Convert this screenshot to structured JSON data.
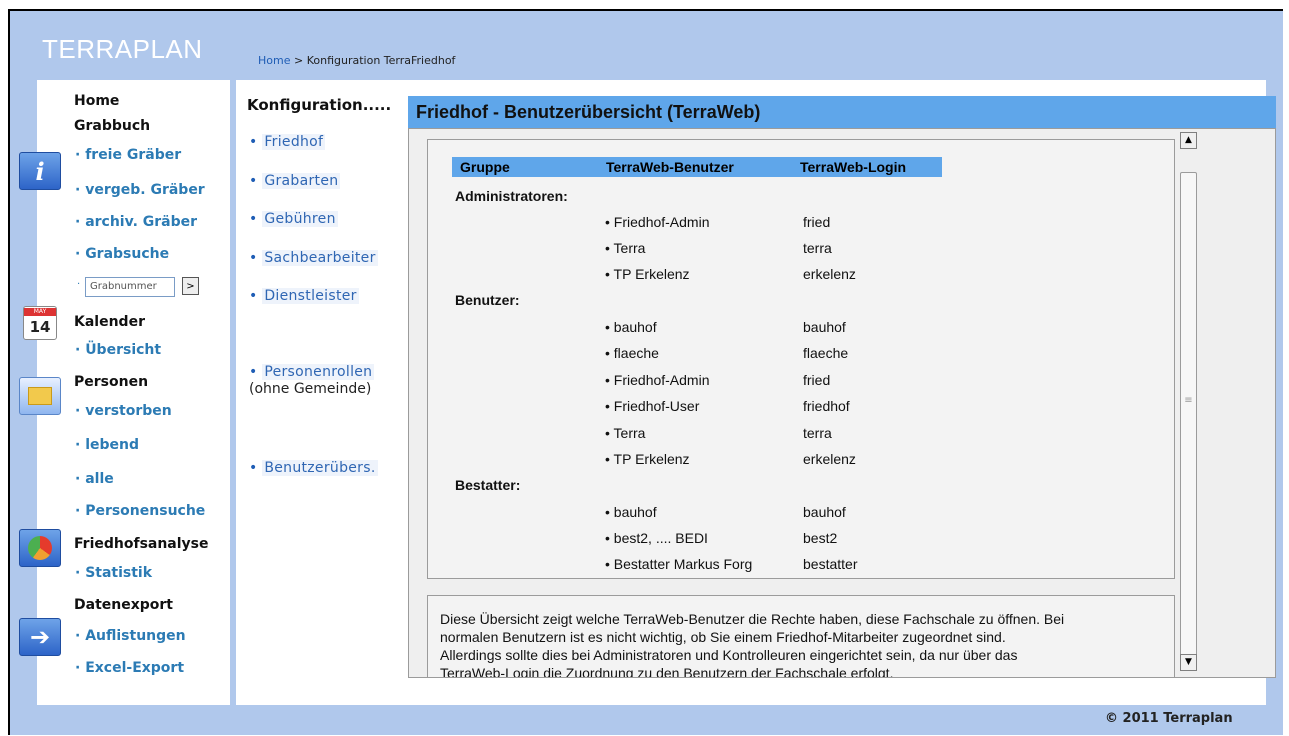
{
  "brand": {
    "logo": "TERRAPLAN"
  },
  "breadcrumb": {
    "home": "Home",
    "separator": " > ",
    "current": "Konfiguration TerraFriedhof"
  },
  "nav": {
    "home": "Home",
    "grabbuch": "Grabbuch",
    "freie": "· freie Gräber",
    "vergeb": "· vergeb. Gräber",
    "archiv": "· archiv. Gräber",
    "grabsuche": "· Grabsuche",
    "grabnummer_placeholder": "Grabnummer",
    "search_btn": ">",
    "kalender": "Kalender",
    "cal_month": "MAY",
    "cal_day": "14",
    "uebersicht": "· Übersicht",
    "personen": "Personen",
    "verstorben": "· verstorben",
    "lebend": "· lebend",
    "alle": "· alle",
    "personensuche": "· Personensuche",
    "friedhofsanalyse": "Friedhofsanalyse",
    "statistik": "· Statistik",
    "datenexport": "Datenexport",
    "auflistungen": "· Auflistungen",
    "excel": "· Excel-Export",
    "info_glyph": "i",
    "arrow_glyph": "➔"
  },
  "config": {
    "title": "Konfiguration.....",
    "bullet": "•",
    "links": [
      "Friedhof",
      "Grabarten",
      "Gebühren",
      "Sachbearbeiter",
      "Dienstleister",
      "Personenrollen",
      "Benutzerübers."
    ],
    "note": "(ohne Gemeinde)"
  },
  "content": {
    "title": "Friedhof - Benutzerübersicht (TerraWeb)",
    "columns": [
      "Gruppe",
      "TerraWeb-Benutzer",
      "TerraWeb-Login"
    ],
    "groups": [
      {
        "name": "Administratoren:",
        "users": [
          [
            "• Friedhof-Admin",
            "fried"
          ],
          [
            "• Terra",
            "terra"
          ],
          [
            "• TP Erkelenz",
            "erkelenz"
          ]
        ]
      },
      {
        "name": "Benutzer:",
        "users": [
          [
            "• bauhof",
            "bauhof"
          ],
          [
            "• flaeche",
            "flaeche"
          ],
          [
            "• Friedhof-Admin",
            "fried"
          ],
          [
            "• Friedhof-User",
            "friedhof"
          ],
          [
            "• Terra",
            "terra"
          ],
          [
            "• TP Erkelenz",
            "erkelenz"
          ]
        ]
      },
      {
        "name": "Bestatter:",
        "users": [
          [
            "• bauhof",
            "bauhof"
          ],
          [
            "• best2, .... BEDI",
            "best2"
          ],
          [
            "• Bestatter Markus Forg",
            "bestatter"
          ]
        ]
      }
    ],
    "description": [
      "Diese Übersicht zeigt welche TerraWeb-Benutzer die Rechte haben, diese Fachschale zu öffnen. Bei",
      "normalen Benutzern ist es nicht wichtig, ob Sie einem Friedhof-Mitarbeiter zugeordnet sind.",
      "Allerdings sollte dies bei Administratoren und Kontrolleuren eingerichtet sein, da nur über das",
      "TerraWeb-Login die Zuordnung zu den Benutzern der Fachschale erfolgt."
    ]
  },
  "scroll": {
    "up": "▲",
    "down": "▼",
    "grip": "≡"
  },
  "footer": {
    "copyright": "© 2011 Terraplan"
  }
}
